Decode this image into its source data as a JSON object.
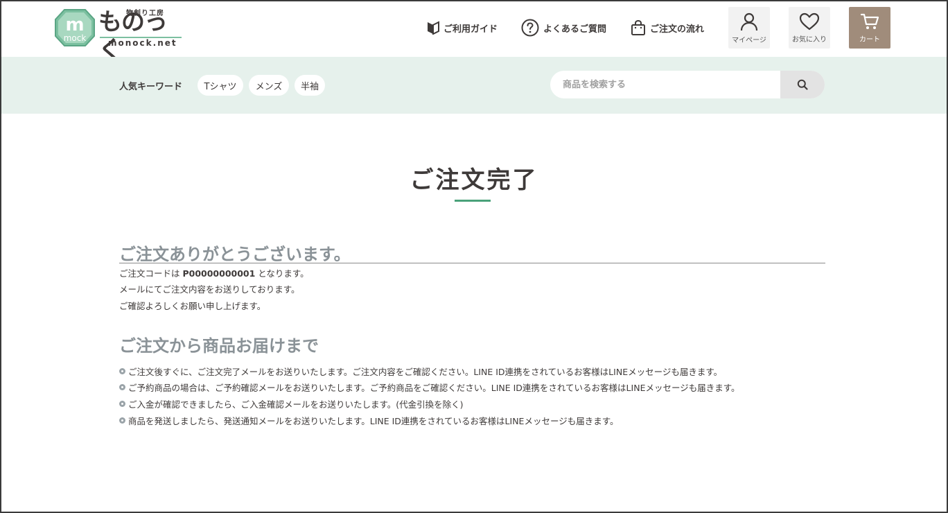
{
  "header": {
    "logo": {
      "badge_text": "mock",
      "tagline": "物創り工房",
      "name": "ものっく",
      "url": "monock.net"
    },
    "nav": [
      {
        "label": "ご利用ガイド",
        "icon": "beginner-mark-icon"
      },
      {
        "label": "よくあるご質問",
        "icon": "question-circle-icon"
      },
      {
        "label": "ご注文の流れ",
        "icon": "shopping-bag-icon"
      }
    ],
    "buttons": {
      "mypage": "マイページ",
      "favorites": "お気に入り",
      "cart": "カート"
    }
  },
  "keywords": {
    "title": "人気キーワード",
    "chips": [
      "Tシャツ",
      "メンズ",
      "半袖"
    ]
  },
  "search": {
    "placeholder": "商品を検索する",
    "value": ""
  },
  "main": {
    "title": "ご注文完了",
    "thanks_heading": "ご注文ありがとうございます。",
    "order_line": {
      "prefix": "ご注文コードは ",
      "code": "P00000000001",
      "suffix": " となります。"
    },
    "lines": [
      "メールにてご注文内容をお送りしております。",
      "ご確認よろしくお願い申し上げます。"
    ],
    "delivery_heading": "ご注文から商品お届けまで",
    "bullets": [
      "ご注文後すぐに、ご注文完了メールをお送りいたします。ご注文内容をご確認ください。LINE ID連携をされているお客様はLINEメッセージも届きます。",
      "ご予約商品の場合は、ご予約確認メールをお送りいたします。ご予約商品をご確認ください。LINE ID連携をされているお客様はLINEメッセージも届きます。",
      "ご入金が確認できましたら、ご入金確認メールをお送りいたします。(代金引換を除く)",
      "商品を発送しましたら、発送通知メールをお送りいたします。LINE ID連携をされているお客様はLINEメッセージも届きます。"
    ]
  },
  "colors": {
    "accent_green": "#4aa27a",
    "keyword_bar_bg": "#e6f1ec",
    "cart_bg": "#a08c7b",
    "text": "#3e3a39",
    "heading_gray": "#8a9297"
  }
}
